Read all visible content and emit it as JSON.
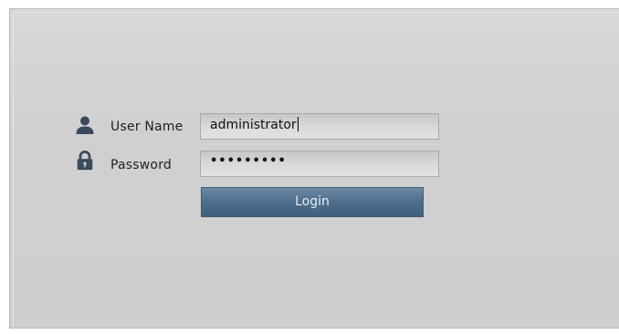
{
  "login_form": {
    "username": {
      "label": "User Name",
      "value": "administrator",
      "icon": "user-icon"
    },
    "password": {
      "label": "Password",
      "masked_value": "•••••••••",
      "icon": "lock-icon"
    },
    "submit_label": "Login"
  },
  "colors": {
    "button_top": "#6d8aa6",
    "button_bottom": "#3f5f7e",
    "panel_background": "#d0d0d0",
    "icon_color": "#3a4a5c"
  }
}
